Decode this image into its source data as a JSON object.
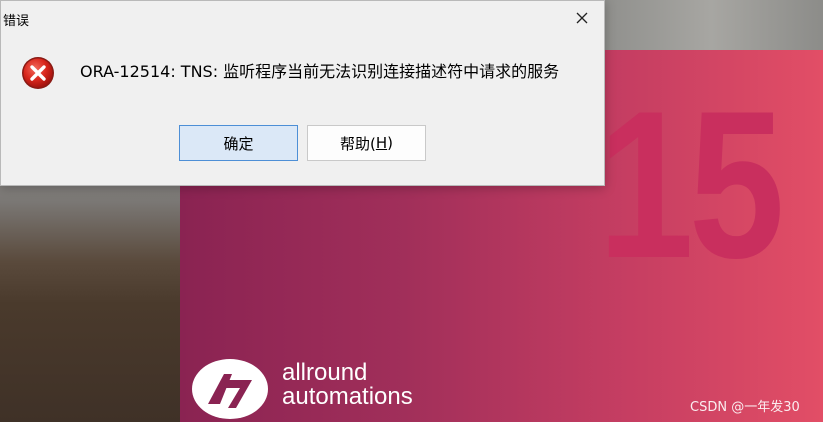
{
  "dialog": {
    "title": "错误",
    "message": "ORA-12514: TNS: 监听程序当前无法识别连接描述符中请求的服务",
    "ok_label": "确定",
    "help_label_prefix": "帮助(",
    "help_mnemonic": "H",
    "help_label_suffix": ")"
  },
  "splash": {
    "version_number": "15",
    "brand_line1": "allround",
    "brand_line2": "automations",
    "colors": {
      "gradient_start": "#8a2352",
      "gradient_end": "#e24e66",
      "number": "#c92f5e"
    }
  },
  "watermark": "CSDN @一年发30",
  "icons": {
    "error": "error-icon",
    "close": "close-icon",
    "logo": "allround-automations-logo-icon"
  }
}
